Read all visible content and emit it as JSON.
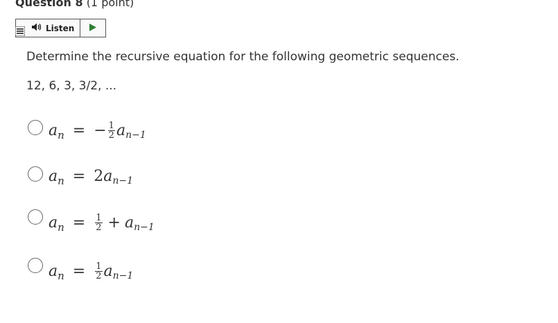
{
  "question": {
    "title_bold": "Question 8",
    "title_points": "(1 point)"
  },
  "listen": {
    "label": "Listen",
    "speaker_icon": "speaker-icon",
    "play_icon": "play-icon",
    "menu_icon": "menu-icon"
  },
  "prompt": "Determine the recursive equation for the following geometric sequences.",
  "sequence": "12, 6, 3, 3/2, ...",
  "options": [
    {
      "lhs": "a",
      "lhs_sub": "n",
      "eq": "=",
      "sign": "−",
      "num": "1",
      "den": "2",
      "op": "",
      "rhs": "a",
      "rhs_sub": "n−1"
    },
    {
      "lhs": "a",
      "lhs_sub": "n",
      "eq": "=",
      "coef": "2",
      "rhs": "a",
      "rhs_sub": "n−1"
    },
    {
      "lhs": "a",
      "lhs_sub": "n",
      "eq": "=",
      "num": "1",
      "den": "2",
      "op": "+",
      "rhs": "a",
      "rhs_sub": "n−1"
    },
    {
      "lhs": "a",
      "lhs_sub": "n",
      "eq": "=",
      "num": "1",
      "den": "2",
      "rhs": "a",
      "rhs_sub": "n−1"
    }
  ]
}
